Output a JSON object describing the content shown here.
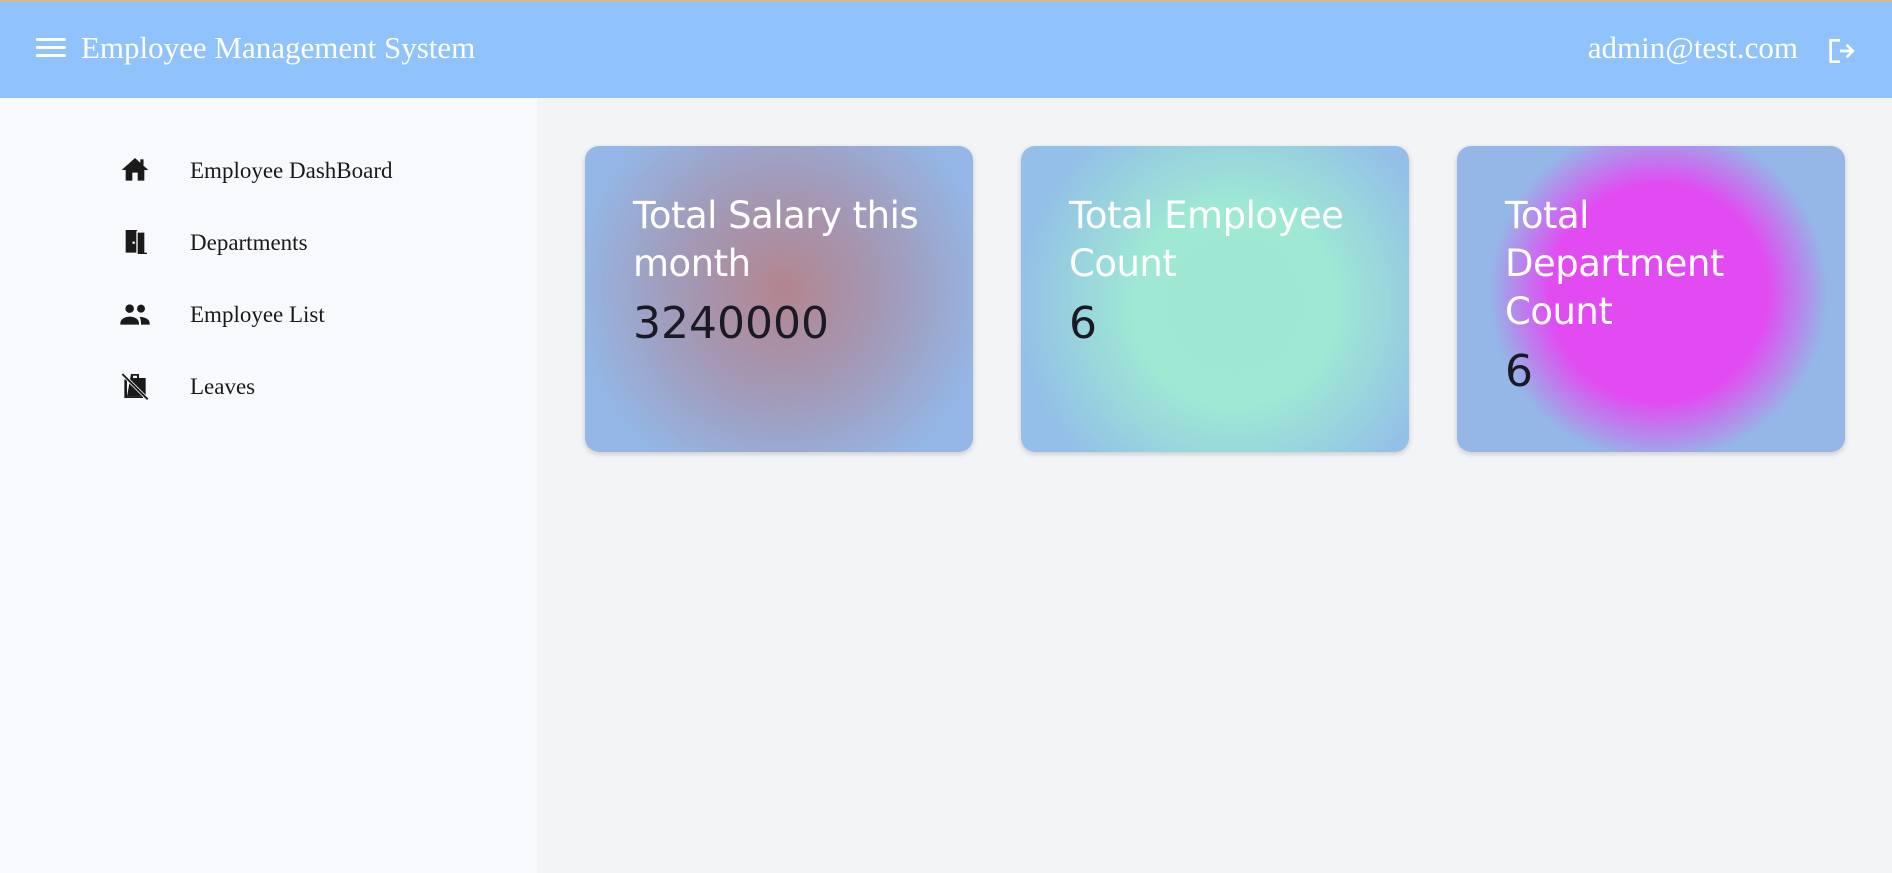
{
  "header": {
    "title": "Employee Management System",
    "user_email": "admin@test.com",
    "icons": {
      "menu": "menu-icon",
      "logout": "logout-icon"
    },
    "background_color": "#90c3fc"
  },
  "sidebar": {
    "items": [
      {
        "label": "Employee DashBoard",
        "icon": "home-icon"
      },
      {
        "label": "Departments",
        "icon": "door-icon"
      },
      {
        "label": "Employee List",
        "icon": "people-icon"
      },
      {
        "label": "Leaves",
        "icon": "work-off-icon"
      }
    ]
  },
  "dashboard": {
    "cards": [
      {
        "title": "Total Salary this month",
        "value": "3240000"
      },
      {
        "title": "Total Employee Count",
        "value": "6"
      },
      {
        "title": "Total Department Count",
        "value": "6"
      }
    ]
  }
}
